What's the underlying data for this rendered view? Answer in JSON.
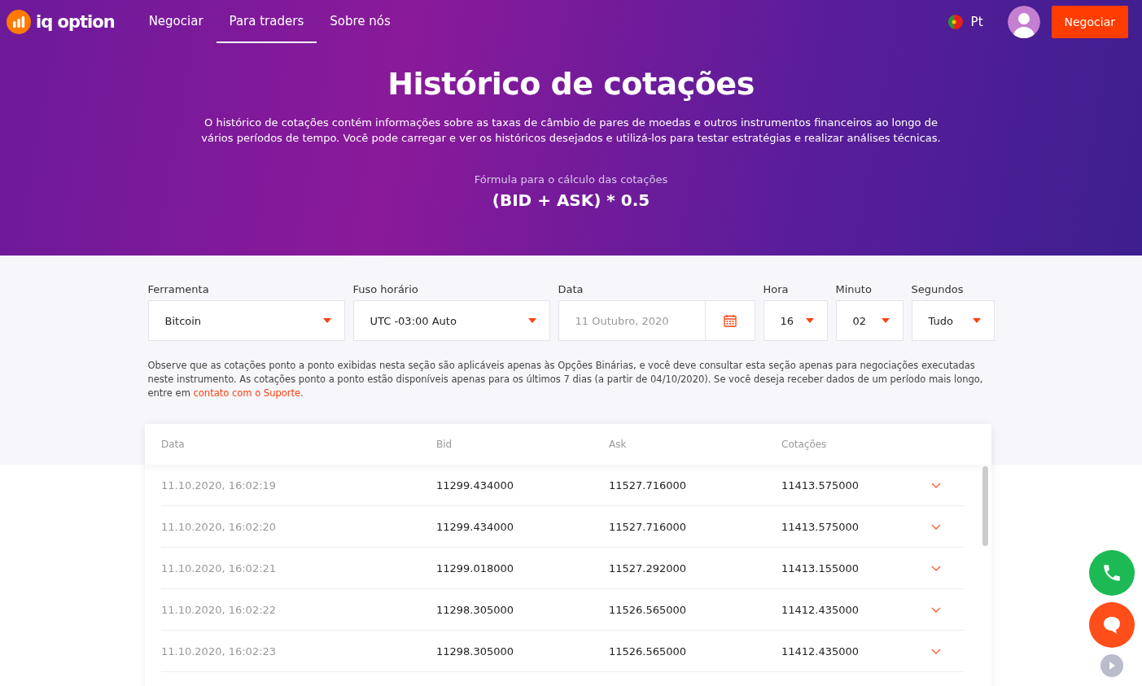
{
  "nav": {
    "logo": "iq option",
    "links": [
      {
        "label": "Negociar",
        "selected": false
      },
      {
        "label": "Para traders",
        "selected": true
      },
      {
        "label": "Sobre nós",
        "selected": false
      }
    ],
    "language": "Pt",
    "cta": "Negociar"
  },
  "hero": {
    "title": "Histórico de cotações",
    "description": "O histórico de cotações contém informações sobre as taxas de câmbio de pares de moedas e outros instrumentos financeiros ao longo de vários períodos de tempo. Você pode carregar e ver os históricos desejados e utilizá-los para testar estratégias e realizar análises técnicas.",
    "formula_label": "Fórmula para o cálculo das cotações",
    "formula": "(BID + ASK) * 0.5"
  },
  "filters": [
    {
      "kind": "select",
      "label": "Ferramenta",
      "value": "Bitcoin"
    },
    {
      "kind": "select",
      "label": "Fuso horário",
      "value": "UTC -03:00 Auto"
    },
    {
      "kind": "date",
      "label": "Data",
      "placeholder": "11 Outubro, 2020"
    },
    {
      "kind": "select",
      "label": "Hora",
      "value": "16"
    },
    {
      "kind": "select",
      "label": "Minuto",
      "value": "02"
    },
    {
      "kind": "select",
      "label": "Segundos",
      "value": "Tudo"
    }
  ],
  "notice": {
    "text": "Observe que as cotações ponto a ponto exibidas nesta seção são aplicáveis apenas às Opções Binárias, e você deve consultar esta seção apenas para negociações executadas neste instrumento. As cotações ponto a ponto estão disponíveis apenas para os últimos 7 dias (a partir de 04/10/2020). Se você deseja receber dados de um período mais longo, entre em",
    "link": "contato com o Suporte",
    "end": "."
  },
  "table": {
    "columns": [
      "Data",
      "Bid",
      "Ask",
      "Cotações"
    ],
    "rows": [
      [
        "11.10.2020, 16:02:19",
        "11299.434000",
        "11527.716000",
        "11413.575000"
      ],
      [
        "11.10.2020, 16:02:20",
        "11299.434000",
        "11527.716000",
        "11413.575000"
      ],
      [
        "11.10.2020, 16:02:21",
        "11299.018000",
        "11527.292000",
        "11413.155000"
      ],
      [
        "11.10.2020, 16:02:22",
        "11298.305000",
        "11526.565000",
        "11412.435000"
      ],
      [
        "11.10.2020, 16:02:23",
        "11298.305000",
        "11526.565000",
        "11412.435000"
      ]
    ]
  }
}
